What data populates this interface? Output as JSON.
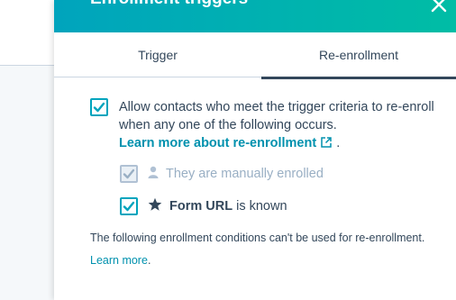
{
  "panel": {
    "title": "Enrollment triggers",
    "tabs": [
      {
        "label": "Trigger",
        "active": false
      },
      {
        "label": "Re-enrollment",
        "active": true
      }
    ]
  },
  "reenroll": {
    "allow_checked": true,
    "allow_text": "Allow contacts who meet the trigger criteria to re-enroll when any one of the following occurs.",
    "learn_more_link": "Learn more about re-enrollment",
    "learn_more_suffix": ".",
    "options": [
      {
        "label": "They are manually enrolled",
        "checked": true,
        "disabled": true,
        "icon": "person-icon"
      },
      {
        "property": "Form URL",
        "suffix": "is known",
        "checked": true,
        "disabled": false,
        "icon": "star-icon"
      }
    ],
    "note_text": "The following enrollment conditions can't be used for re-enrollment.",
    "note_link": "Learn more",
    "note_suffix": "."
  },
  "colors": {
    "accent": "#00a4bd",
    "header_gradient_end": "#00bda5",
    "text": "#33475b",
    "link": "#0091ae",
    "muted": "#99afc4"
  }
}
